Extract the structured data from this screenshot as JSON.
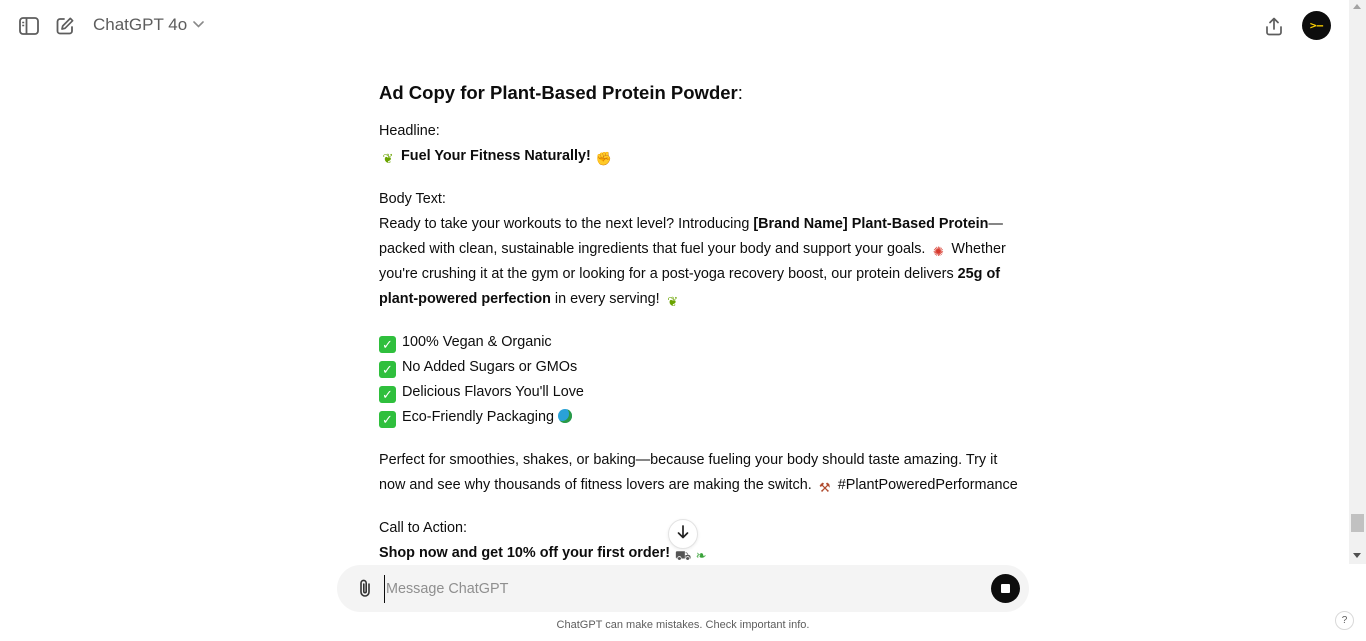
{
  "header": {
    "model_name": "ChatGPT 4o",
    "avatar_text": ">–",
    "icons": [
      "sidebar-toggle-icon",
      "new-chat-icon",
      "chevron-down-icon",
      "share-icon"
    ]
  },
  "message": {
    "title": "Ad Copy for Plant-Based Protein Powder",
    "title_suffix": ":",
    "headline_label": "Headline:",
    "headline_text": "Fuel Your Fitness Naturally!",
    "body_label": "Body Text:",
    "body_1": "Ready to take your workouts to the next level? Introducing ",
    "body_bold_1": "[Brand Name] Plant-Based Protein",
    "body_2": "—packed with clean, sustainable ingredients that fuel your body and support your goals. ",
    "body_3": " Whether you're crushing it at the gym or looking for a post-yoga recovery boost, our protein delivers ",
    "body_bold_2": "25g of plant-powered perfection",
    "body_4": " in every serving! ",
    "features": [
      "100% Vegan & Organic",
      "No Added Sugars or GMOs",
      "Delicious Flavors You'll Love",
      "Eco-Friendly Packaging"
    ],
    "closing_1": "Perfect for smoothies, shakes, or baking—because fueling your body should taste amazing. Try it now and see why thousands of fitness lovers are making the switch. ",
    "hashtag": "#PlantPoweredPerformance",
    "cta_label": "Call to Action:",
    "cta_text": "Shop now and get 10% off your first order!"
  },
  "composer": {
    "placeholder": "Message ChatGPT",
    "value": ""
  },
  "footer": {
    "disclaimer": "ChatGPT can make mistakes. Check important info.",
    "help": "?"
  },
  "colors": {
    "accent_dark": "#0d0d0d",
    "composer_bg": "#f4f4f4",
    "check_green": "#2fbf3d"
  }
}
